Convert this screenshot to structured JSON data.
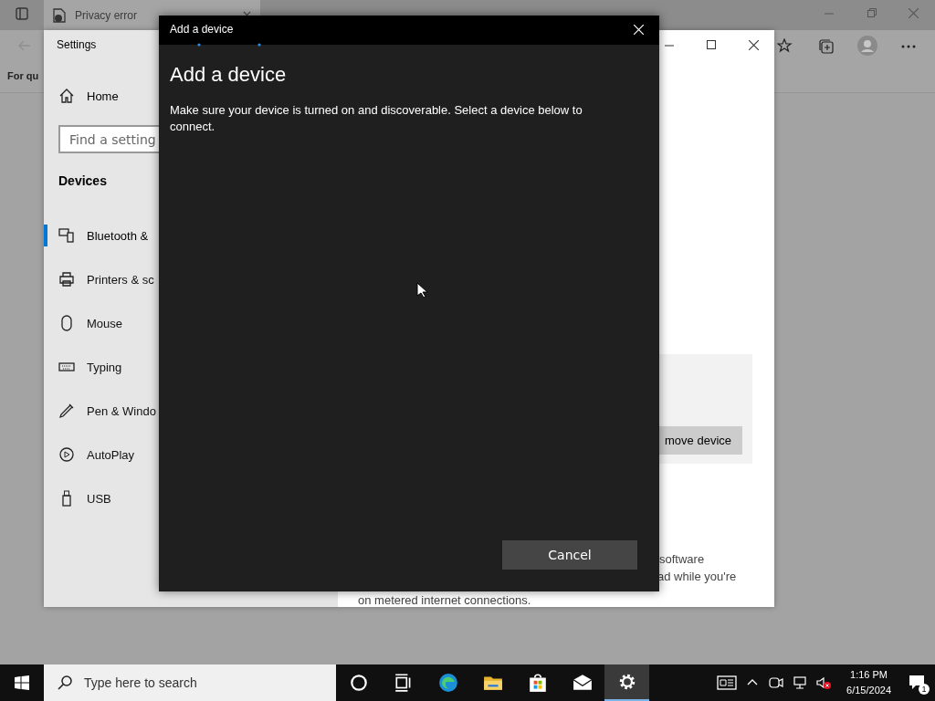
{
  "browser": {
    "tab_title": "Privacy error",
    "partial_text": "For qu"
  },
  "settings": {
    "title": "Settings",
    "home": "Home",
    "search_placeholder": "Find a setting",
    "section": "Devices",
    "items": [
      {
        "kind": "bluetooth",
        "label": "Bluetooth &",
        "selected": true
      },
      {
        "kind": "printer",
        "label": "Printers & sc",
        "selected": false
      },
      {
        "kind": "mouse",
        "label": "Mouse",
        "selected": false
      },
      {
        "kind": "keyboard",
        "label": "Typing",
        "selected": false
      },
      {
        "kind": "pen",
        "label": "Pen & Windo",
        "selected": false
      },
      {
        "kind": "autoplay",
        "label": "AutoPlay",
        "selected": false
      },
      {
        "kind": "usb",
        "label": "USB",
        "selected": false
      }
    ],
    "remove_button": "move device",
    "texts": [
      "software",
      "ad while you're",
      "on metered internet connections."
    ]
  },
  "dialog": {
    "title": "Add a device",
    "heading": "Add a device",
    "description": "Make sure your device is turned on and discoverable. Select a device below to connect.",
    "cancel": "Cancel"
  },
  "taskbar": {
    "search_placeholder": "Type here to search",
    "apps": [
      {
        "kind": "cortana",
        "selected": false
      },
      {
        "kind": "taskview",
        "selected": false
      },
      {
        "kind": "edge",
        "selected": false
      },
      {
        "kind": "explorer",
        "selected": false
      },
      {
        "kind": "store",
        "selected": false
      },
      {
        "kind": "mail",
        "selected": false
      },
      {
        "kind": "settings",
        "selected": true
      }
    ],
    "time": "1:16 PM",
    "date": "6/15/2024",
    "notifications": "1"
  }
}
